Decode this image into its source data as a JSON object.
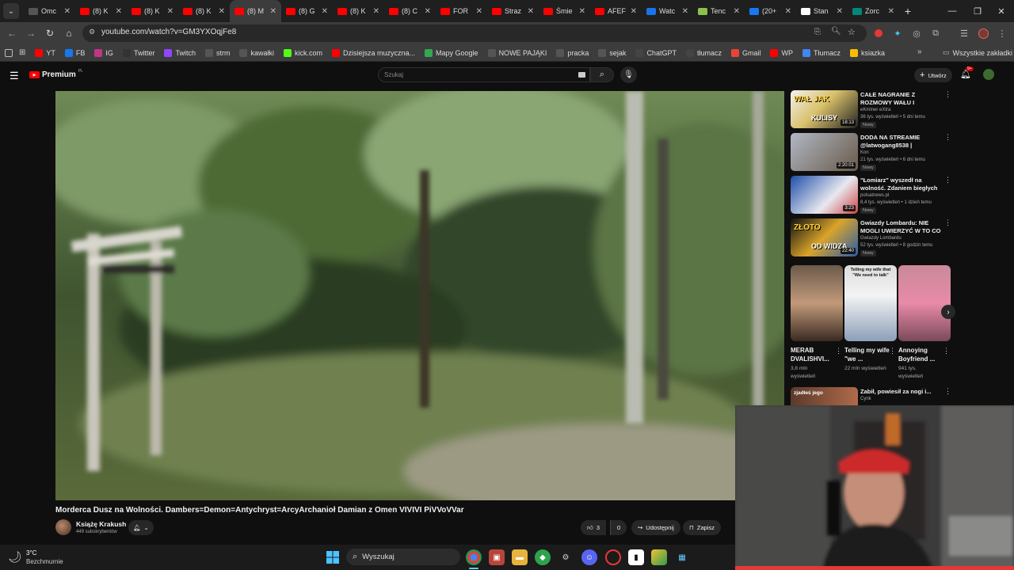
{
  "tabs": [
    {
      "label": "Omc",
      "color": "#555"
    },
    {
      "label": "(8) K",
      "color": "#ff0000"
    },
    {
      "label": "(8) K",
      "color": "#ff0000"
    },
    {
      "label": "(8) K",
      "color": "#ff0000"
    },
    {
      "label": "(8) M",
      "color": "#ff0000",
      "active": true
    },
    {
      "label": "(8) G",
      "color": "#ff0000"
    },
    {
      "label": "(8) K",
      "color": "#ff0000"
    },
    {
      "label": "(8) C",
      "color": "#ff0000"
    },
    {
      "label": "FOR",
      "color": "#ff0000"
    },
    {
      "label": "Straz",
      "color": "#ff0000"
    },
    {
      "label": "Śmie",
      "color": "#ff0000"
    },
    {
      "label": "AFEF",
      "color": "#ff0000"
    },
    {
      "label": "Watc",
      "color": "#1a73e8"
    },
    {
      "label": "Tenc",
      "color": "#8bc34a"
    },
    {
      "label": "(20+",
      "color": "#1877f2"
    },
    {
      "label": "Stan",
      "color": "#ffffff"
    },
    {
      "label": "Zorc",
      "color": "#00897b"
    }
  ],
  "address": {
    "url": "youtube.com/watch?v=GM3YXOqjFe8"
  },
  "bookmarks": [
    {
      "label": "YT",
      "color": "#ff0000"
    },
    {
      "label": "FB",
      "color": "#1877f2"
    },
    {
      "label": "IG",
      "color": "#c13584"
    },
    {
      "label": "Twitter",
      "color": "#333"
    },
    {
      "label": "Twitch",
      "color": "#9146ff"
    },
    {
      "label": "strm",
      "color": "#555"
    },
    {
      "label": "kawałki",
      "color": "#555"
    },
    {
      "label": "kick.com",
      "color": "#53fc18"
    },
    {
      "label": "Dzisiejsza muzyczna...",
      "color": "#ff0000"
    },
    {
      "label": "Mapy Google",
      "color": "#34a853"
    },
    {
      "label": "NOWE PAJĄKI",
      "color": "#555"
    },
    {
      "label": "pracka",
      "color": "#555"
    },
    {
      "label": "sejak",
      "color": "#555"
    },
    {
      "label": "ChatGPT",
      "color": "#444"
    },
    {
      "label": "tłumacz",
      "color": "#444"
    },
    {
      "label": "Gmail",
      "color": "#ea4335"
    },
    {
      "label": "WP",
      "color": "#ff0000"
    },
    {
      "label": "Tłumacz",
      "color": "#4285f4"
    },
    {
      "label": "ksiazka",
      "color": "#fbbc04"
    }
  ],
  "all_bookmarks": "Wszystkie zakładki",
  "yt": {
    "logo": "Premium",
    "logo_sup": "PL",
    "search_placeholder": "Szukaj",
    "create_label": "Utwórz",
    "notif_count": "9+"
  },
  "video": {
    "title": "Morderca Dusz na Wolności. Dambers=Demon=Antychryst=ArcyArchanioł Damian z Omen VIVIVI PiVVoVVar",
    "channel": "Książę Krakush",
    "subs": "449 subskrybentów",
    "likes": "3",
    "dislikes": "0",
    "share": "Udostępnij",
    "save": "Zapisz"
  },
  "recommendations": [
    {
      "title": "CAŁE NAGRANIE Z ROZMOWY WAŁU I BIZNESMENEK",
      "channel": "eKminer eXtra",
      "meta": "36 tys. wyświetleń • 5 dni temu",
      "badge": "Nowy",
      "duration": "18:13",
      "thumb_text": "WAŁ JAK",
      "thumb_sub": "KULISY"
    },
    {
      "title": "DODA NA STREAMIE @latwogang8538 | WPŁACAJ ...",
      "channel": "Kon",
      "meta": "21 tys. wyświetleń • 6 dni temu",
      "badge": "Nowy",
      "duration": "2:20:01",
      "thumb_text": "",
      "thumb_sub": ""
    },
    {
      "title": "\"Łomiarz\" wyszedł na wolność. Zdaniem biegłych może znów ...",
      "channel": "polsatnews.pl",
      "meta": "8,4 tys. wyświetleń • 1 dzień temu",
      "badge": "Nowy",
      "duration": "3:23",
      "thumb_text": "",
      "thumb_sub": ""
    },
    {
      "title": "Gwiazdy Lombardu: NIE MOGLI UWIERZYĆ W TO CO DOSTALI...",
      "channel": "Gwiazdy Lombardu",
      "meta": "52 tys. wyświetleń • 8 godzin temu",
      "badge": "Nowy",
      "duration": "22:40",
      "thumb_text": "ZŁOTO",
      "thumb_sub": "OD WIDZA"
    }
  ],
  "shorts": [
    {
      "title": "MERAB DVALISHVI...",
      "views": "3,8 mln wyświetleń",
      "overlay": ""
    },
    {
      "title": "Telling my wife \"we ...",
      "views": "22 mln wyświetleń",
      "overlay": "Telling my wife that \"We need to talk\""
    },
    {
      "title": "Annoying Boyfriend ...",
      "views": "941 tys. wyświetleń",
      "overlay": ""
    }
  ],
  "rec5": {
    "title": "Zabił, powiesił za nogi i...",
    "channel": "Cynk",
    "thumb_text": "zjadłeś jego"
  },
  "taskbar": {
    "weather_temp": "3°C",
    "weather_desc": "Bezchmurnie",
    "search_label": "Wyszukaj"
  },
  "colors": {
    "bg": "#0f0f0f",
    "accent": "#ff0000",
    "chrome_bar": "#3c3c3c"
  }
}
